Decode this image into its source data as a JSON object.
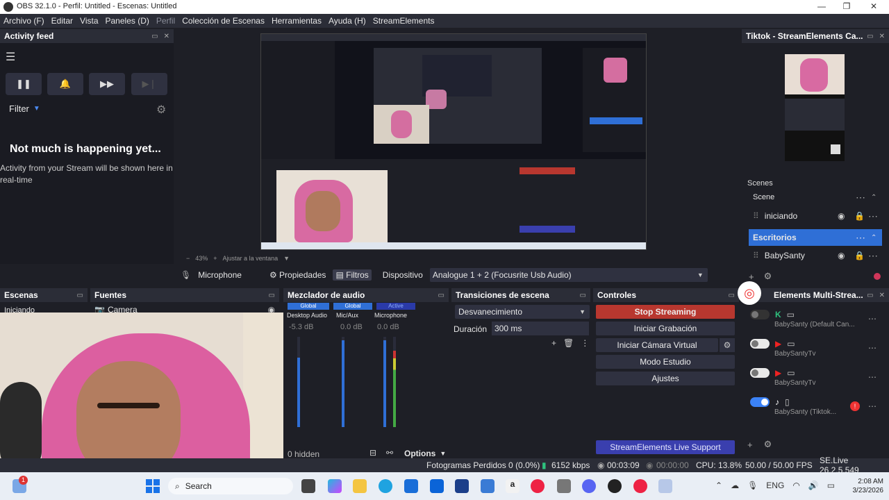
{
  "window": {
    "title": "OBS 32.1.0 - Perfil: Untitled - Escenas: Untitled"
  },
  "menu": [
    "Archivo (F)",
    "Editar",
    "Vista",
    "Paneles (D)",
    "Perfil",
    "Colección de Escenas",
    "Herramientas",
    "Ayuda (H)",
    "StreamElements"
  ],
  "activity": {
    "title": "Activity feed",
    "filter": "Filter",
    "empty_title": "Not much is happening yet...",
    "empty_text": "Activity from your Stream will be shown here in real-time"
  },
  "tiktok_dock": {
    "title": "Tiktok - StreamElements Ca..."
  },
  "scenes_mini": {
    "label": "Scenes",
    "scene": "Scene",
    "items": [
      {
        "name": "iniciando"
      },
      {
        "name": "Escritorios"
      },
      {
        "name": "BabySanty"
      }
    ]
  },
  "multistream": {
    "title": "Elements Multi-Strea...",
    "rows": [
      {
        "name": "BabySanty (Default Can..."
      },
      {
        "name": "BabySantyTv"
      },
      {
        "name": "BabySantyTv"
      },
      {
        "name": "BabySanty (Tiktok..."
      }
    ]
  },
  "source_bar": {
    "source": "Microphone",
    "properties": "Propiedades",
    "filters": "Filtros",
    "device_label": "Dispositivo",
    "device_value": "Analogue 1 + 2 (Focusrite Usb Audio)"
  },
  "zoom": {
    "level": "43%",
    "fit": "Ajustar a la ventana"
  },
  "docks": {
    "scenes": {
      "title": "Escenas",
      "item": "Iniciando"
    },
    "sources": {
      "title": "Fuentes",
      "item": "Camera"
    },
    "mixer": {
      "title": "Mezclador de audio",
      "channels": [
        {
          "badge": "Global",
          "name": "Desktop Audio",
          "db": "-5.3 dB"
        },
        {
          "badge": "Global",
          "name": "Mic/Aux",
          "db": "0.0 dB"
        },
        {
          "badge": "Active",
          "name": "Microphone",
          "db": "0.0 dB"
        }
      ],
      "scale": [
        "6",
        "0",
        "-6",
        "-12",
        "-18",
        "-24",
        "-30",
        "-36",
        "-42",
        "-48",
        "-54",
        "-60"
      ],
      "hidden": "0 hidden",
      "options": "Options"
    },
    "transitions": {
      "title": "Transiciones de escena",
      "type": "Desvanecimiento",
      "duration_label": "Duración",
      "duration_value": "300 ms"
    },
    "controls": {
      "title": "Controles",
      "buttons": [
        "Stop Streaming",
        "Iniciar Grabación",
        "Iniciar Cámara Virtual",
        "Modo Estudio",
        "Ajustes"
      ],
      "support": "StreamElements Live Support"
    }
  },
  "status": {
    "dropped": "Fotogramas Perdidos 0 (0.0%)",
    "bitrate": "6152 kbps",
    "stream_time": "00:03:09",
    "rec_time": "00:00:00",
    "cpu": "CPU: 13.8%",
    "fps": "50.00 / 50.00 FPS",
    "version": "SE.Live 26.2.5.549"
  },
  "taskbar": {
    "search": "Search",
    "lang": "ENG",
    "time": "2:08 AM",
    "date": "3/23/2026",
    "badge": "1"
  },
  "colors": {
    "accent": "#2f6fd6",
    "stop": "#b8372f",
    "support": "#3a3fae"
  }
}
